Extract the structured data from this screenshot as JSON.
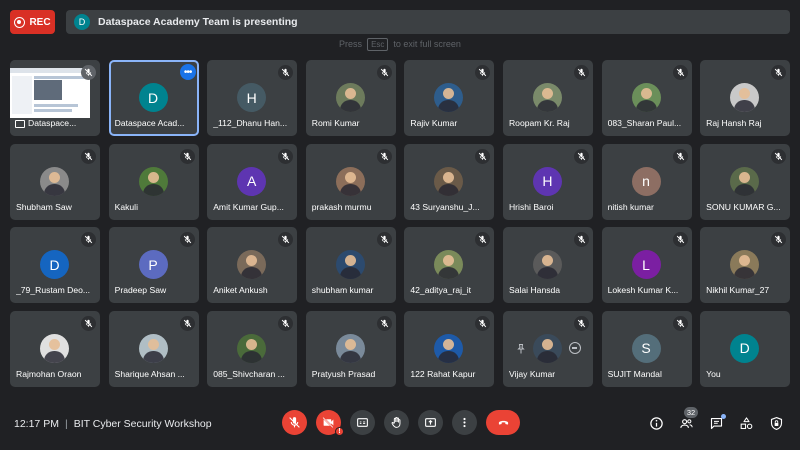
{
  "topbar": {
    "rec_label": "REC",
    "presenter_initial": "D",
    "presenting_text": "Dataspace Academy Team is presenting"
  },
  "esc_hint": {
    "before": "Press",
    "key": "Esc",
    "after": "to exit full screen"
  },
  "participants": [
    {
      "name": "Dataspace...",
      "kind": "screen"
    },
    {
      "name": "Dataspace Acad...",
      "initial": "D",
      "color": "#00838f",
      "kind": "letter",
      "active": true
    },
    {
      "name": "_112_Dhanu Han...",
      "initial": "H",
      "color": "#455a64",
      "kind": "letter"
    },
    {
      "name": "Romi Kumar",
      "color": "#6d7b5c",
      "kind": "photo"
    },
    {
      "name": "Rajiv Kumar",
      "color": "#2e5d8c",
      "kind": "photo"
    },
    {
      "name": "Roopam Kr. Raj",
      "color": "#7a8a6a",
      "kind": "photo"
    },
    {
      "name": "083_Sharan Paul...",
      "color": "#6b8f5a",
      "kind": "photo"
    },
    {
      "name": "Raj Hansh Raj",
      "color": "#c9c9c9",
      "kind": "photo"
    },
    {
      "name": "Shubham Saw",
      "color": "#8a8a8a",
      "kind": "photo"
    },
    {
      "name": "Kakuli",
      "color": "#4f7a3a",
      "kind": "photo"
    },
    {
      "name": "Amit Kumar Gup...",
      "initial": "A",
      "color": "#5e35b1",
      "kind": "letter"
    },
    {
      "name": "prakash murmu",
      "color": "#8c6e5a",
      "kind": "photo"
    },
    {
      "name": "43 Suryanshu_J...",
      "color": "#6a5a48",
      "kind": "photo"
    },
    {
      "name": "Hrishi Baroi",
      "initial": "H",
      "color": "#5e35b1",
      "kind": "letter"
    },
    {
      "name": "nitish kumar",
      "initial": "n",
      "color": "#8d6e63",
      "kind": "letter"
    },
    {
      "name": "SONU KUMAR G...",
      "color": "#5a6a4a",
      "kind": "photo"
    },
    {
      "name": "_79_Rustam Deo...",
      "initial": "D",
      "color": "#1565c0",
      "kind": "letter"
    },
    {
      "name": "Pradeep Saw",
      "initial": "P",
      "color": "#5c6bc0",
      "kind": "letter"
    },
    {
      "name": "Aniket Ankush",
      "color": "#7a6a5a",
      "kind": "photo"
    },
    {
      "name": "shubham kumar",
      "color": "#2c4a6e",
      "kind": "photo"
    },
    {
      "name": "42_aditya_raj_it",
      "color": "#7a8a5a",
      "kind": "photo"
    },
    {
      "name": "Salai Hansda",
      "color": "#5a5a5a",
      "kind": "photo"
    },
    {
      "name": "Lokesh Kumar K...",
      "initial": "L",
      "color": "#7b1fa2",
      "kind": "letter"
    },
    {
      "name": "Nikhil Kumar_27",
      "color": "#8a7a5a",
      "kind": "photo"
    },
    {
      "name": "Rajmohan Oraon",
      "color": "#e0e0e0",
      "kind": "photo"
    },
    {
      "name": "Sharique Ahsan ...",
      "color": "#b0bec5",
      "kind": "photo"
    },
    {
      "name": "085_Shivcharan ...",
      "color": "#4a6a3a",
      "kind": "photo"
    },
    {
      "name": "Pratyush Prasad",
      "color": "#7a8a9a",
      "kind": "photo"
    },
    {
      "name": "122 Rahat Kapur",
      "color": "#1e5aa8",
      "kind": "photo"
    },
    {
      "name": "Vijay Kumar",
      "color": "#3a4a5a",
      "kind": "photo",
      "pinhover": true
    },
    {
      "name": "SUJIT Mandal",
      "initial": "S",
      "color": "#546e7a",
      "kind": "letter"
    },
    {
      "name": "You",
      "initial": "D",
      "color": "#00838f",
      "kind": "letter",
      "self": true
    }
  ],
  "bottom": {
    "time": "12:17 PM",
    "separator": "|",
    "meeting_name": "BIT Cyber Security Workshop",
    "participant_count": "32",
    "camera_alert": "!"
  },
  "colors": {
    "background": "#202124",
    "tile": "#3c4043",
    "danger": "#ea4335",
    "accent": "#8ab4f8"
  }
}
